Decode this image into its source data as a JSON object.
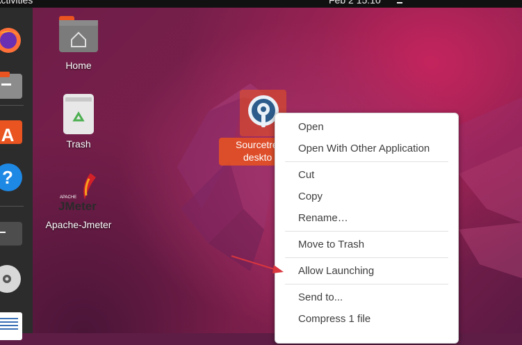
{
  "top_bar": {
    "activities": "Activities",
    "clock": "Feb 2  15:10"
  },
  "dock": {
    "items": [
      "firefox-icon",
      "files-icon",
      "app-center-icon",
      "help-icon",
      "terminal-icon",
      "disc-icon",
      "text-editor-icon"
    ]
  },
  "desktop": {
    "icons": [
      {
        "label": "Home",
        "icon": "home-folder-icon"
      },
      {
        "label": "Trash",
        "icon": "trash-icon"
      },
      {
        "label": "Apache-Jmeter",
        "icon": "jmeter-icon"
      }
    ],
    "selected": {
      "label_line1": "Sourcetre",
      "label_line2": "deskto",
      "icon": "sourcetree-icon"
    },
    "jmeter_logo": {
      "small": "APACHE",
      "big": "JMeter"
    }
  },
  "context_menu": {
    "items": [
      "Open",
      "Open With Other Application",
      "Cut",
      "Copy",
      "Rename…",
      "Move to Trash",
      "Allow Launching",
      "Send to...",
      "Compress 1 file"
    ]
  },
  "colors": {
    "accent": "#e95420",
    "arrow": "#d9363e",
    "dock": "#2c2c2c"
  }
}
